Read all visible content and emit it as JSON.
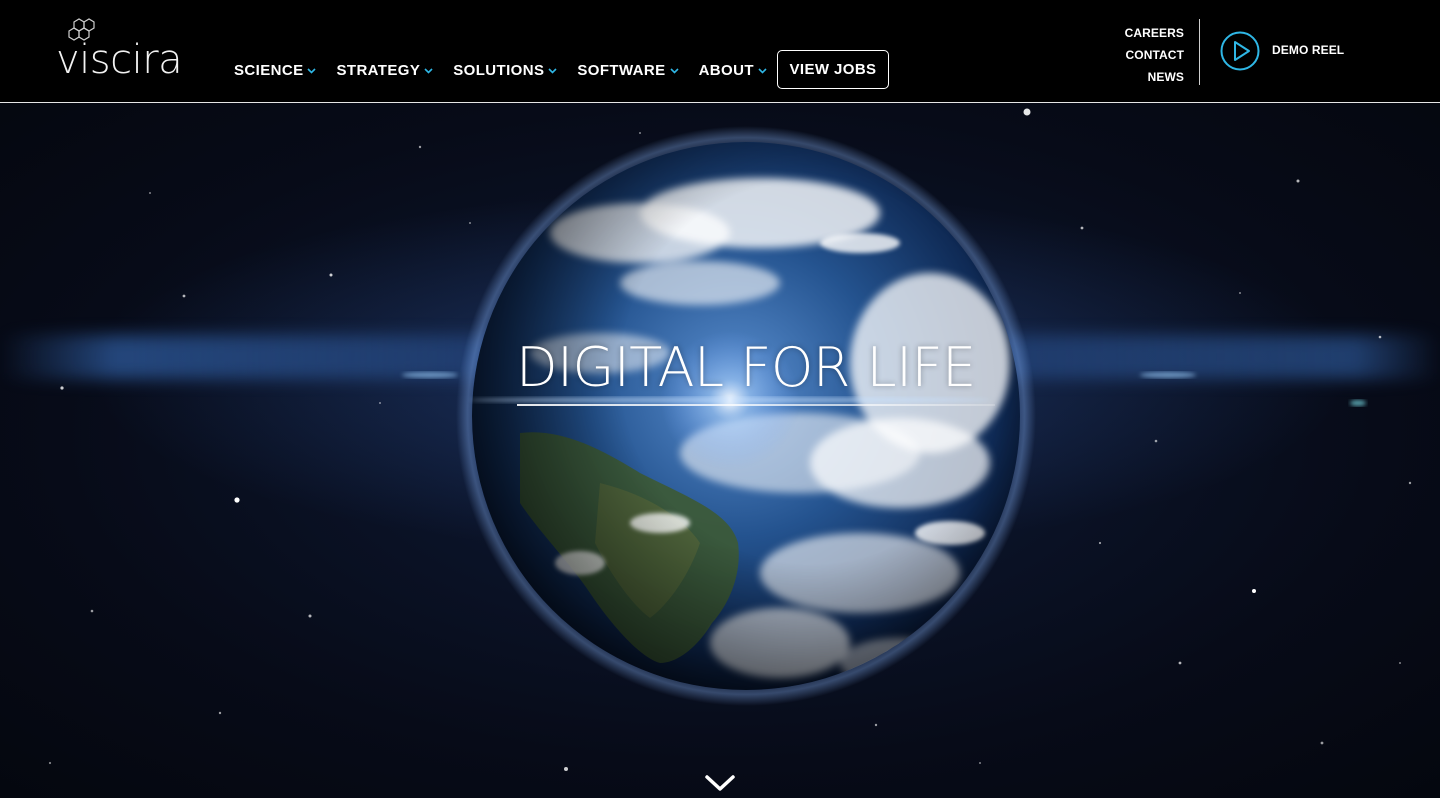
{
  "brand": {
    "name": "viscira",
    "logo_icon": "hexagon-cluster-icon"
  },
  "nav": {
    "items": [
      {
        "label": "SCIENCE",
        "icon": "chevron-down-icon"
      },
      {
        "label": "STRATEGY",
        "icon": "chevron-down-icon"
      },
      {
        "label": "SOLUTIONS",
        "icon": "chevron-down-icon"
      },
      {
        "label": "SOFTWARE",
        "icon": "chevron-down-icon"
      },
      {
        "label": "ABOUT",
        "icon": "chevron-down-icon"
      }
    ],
    "cta_label": "VIEW JOBS"
  },
  "utility": {
    "links": [
      "CAREERS",
      "CONTACT",
      "NEWS"
    ],
    "demo_label": "DEMO REEL",
    "demo_icon": "play-circle-icon"
  },
  "hero": {
    "headline": "DIGITAL FOR LIFE",
    "background": "earth-from-space",
    "scroll_icon": "chevron-down-icon"
  },
  "colors": {
    "header_bg": "#000000",
    "accent": "#2fb7e6",
    "text": "#ffffff"
  }
}
